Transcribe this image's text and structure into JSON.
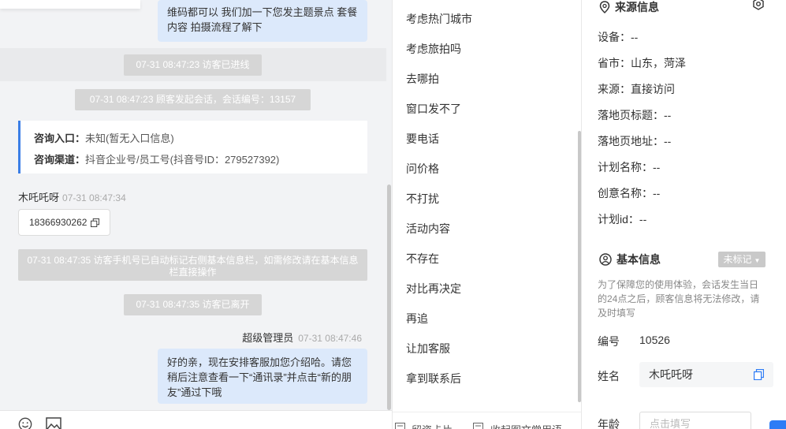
{
  "chat": {
    "agent_msg_top": "维码都可以 我们加一下您发主题景点 套餐内容 拍摄流程了解下",
    "sys_enter": "07-31 08:47:23 访客已进线",
    "sys_session": "07-31 08:47:23 顾客发起会话，会话编号：13157",
    "info_card": {
      "entry_label": "咨询入口：",
      "entry_value": "未知(暂无入口信息)",
      "channel_label": "咨询渠道：",
      "channel_value": "抖音企业号/员工号(抖音号ID：279527392)"
    },
    "visitor_name": "木吒吒呀",
    "visitor_time": "07-31 08:47:34",
    "visitor_phone": "18366930262",
    "sys_auto_mark": "07-31 08:47:35 访客手机号已自动标记右侧基本信息栏，如需修改请在基本信息栏直接操作",
    "sys_leave": "07-31 08:47:35 访客已离开",
    "agent_name": "超级管理员",
    "agent_time": "07-31 08:47:46",
    "agent_msg_bottom": "好的亲，现在安排客服加您介绍哈。请您稍后注意查看一下“通讯录”并点击“新的朋友”通过下哦"
  },
  "toolbar": {
    "icons": [
      "emoji-icon",
      "image-icon"
    ]
  },
  "quick_replies": {
    "items": [
      "考虑热门城市",
      "考虑旅拍吗",
      "去哪拍",
      "窗口发不了",
      "要电话",
      "问价格",
      "不打扰",
      "活动内容",
      "不存在",
      "对比再决定",
      "再追",
      "让加客服",
      "拿到联系后"
    ],
    "footer_left": "留资卡片",
    "footer_right": "收起图文常用语"
  },
  "side": {
    "source_title": "来源信息",
    "source_fields": [
      {
        "label": "设备：",
        "value": "--"
      },
      {
        "label": "省市：",
        "value": "山东，菏泽"
      },
      {
        "label": "来源：",
        "value": "直接访问"
      },
      {
        "label": "落地页标题：",
        "value": "--"
      },
      {
        "label": "落地页地址：",
        "value": "--"
      },
      {
        "label": "计划名称：",
        "value": "--"
      },
      {
        "label": "创意名称：",
        "value": "--"
      },
      {
        "label": "计划id：",
        "value": "--"
      }
    ],
    "basic_title": "基本信息",
    "unmarked_label": "未标记",
    "hint": "为了保障您的使用体验，会话发生当日的24点之后，顾客信息将无法修改，请及时填写",
    "id_label": "编号",
    "id_value": "10526",
    "name_label": "姓名",
    "name_value": "木吒吒呀",
    "age_label": "年龄",
    "age_placeholder": "点击填写"
  },
  "colors": {
    "accent": "#3b7ee6",
    "agent_bubble": "#dce9fb",
    "system_bubble": "#d6d6d6",
    "chat_bg": "#f2f3f5"
  }
}
